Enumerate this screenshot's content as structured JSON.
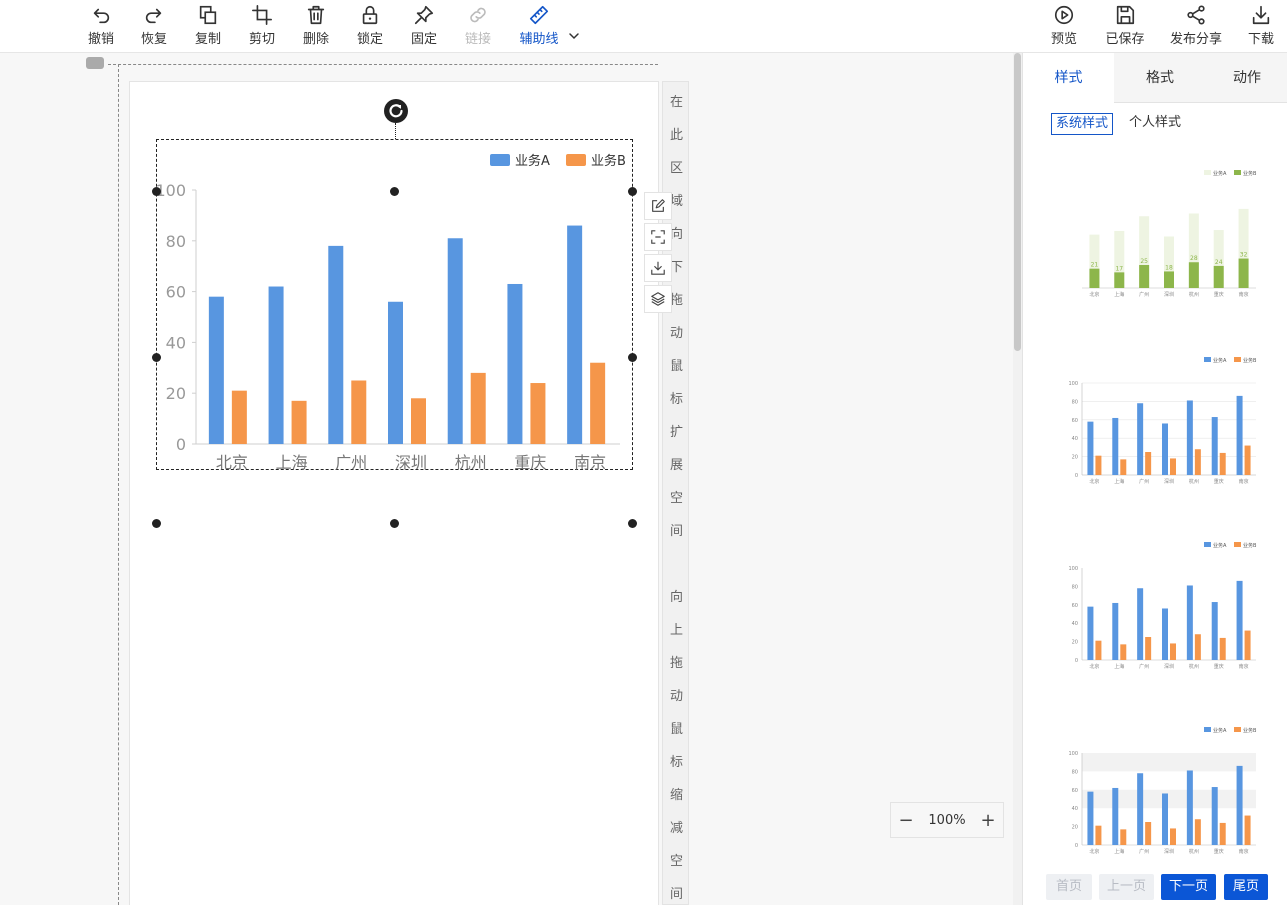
{
  "toolbar": {
    "left": [
      {
        "label": "撤销",
        "icon": "undo-icon"
      },
      {
        "label": "恢复",
        "icon": "redo-icon"
      },
      {
        "label": "复制",
        "icon": "copy-icon"
      },
      {
        "label": "剪切",
        "icon": "crop-icon"
      },
      {
        "label": "删除",
        "icon": "trash-icon"
      },
      {
        "label": "锁定",
        "icon": "lock-icon"
      },
      {
        "label": "固定",
        "icon": "pin-icon"
      },
      {
        "label": "链接",
        "icon": "link-icon"
      },
      {
        "label": "辅助线",
        "icon": "ruler-icon"
      }
    ],
    "right": [
      {
        "label": "预览",
        "icon": "play-icon"
      },
      {
        "label": "已保存",
        "icon": "save-icon"
      },
      {
        "label": "发布分享",
        "icon": "share-icon"
      },
      {
        "label": "下载",
        "icon": "download-icon"
      }
    ]
  },
  "canvas": {
    "hint_top": [
      "在",
      "此",
      "区",
      "域",
      "向",
      "下",
      "拖",
      "动",
      "鼠",
      "标",
      "扩",
      "展",
      "空",
      "间"
    ],
    "hint_bottom": [
      "向",
      "上",
      "拖",
      "动",
      "鼠",
      "标",
      "缩",
      "减",
      "空",
      "间"
    ],
    "zoom": "100%"
  },
  "chart_data": {
    "type": "bar",
    "categories": [
      "北京",
      "上海",
      "广州",
      "深圳",
      "杭州",
      "重庆",
      "南京"
    ],
    "series": [
      {
        "name": "业务A",
        "values": [
          58,
          62,
          78,
          56,
          81,
          63,
          86
        ],
        "color": "#5896e0"
      },
      {
        "name": "业务B",
        "values": [
          21,
          17,
          25,
          18,
          28,
          24,
          32
        ],
        "color": "#f5964a"
      }
    ],
    "ylim": [
      0,
      100
    ],
    "yticks": [
      0,
      20,
      40,
      60,
      80,
      100
    ],
    "legend": "top-right",
    "grid": false
  },
  "panel": {
    "tabs": [
      "样式",
      "格式",
      "动作"
    ],
    "active_tab": "样式",
    "subtabs": [
      "系统样式",
      "个人样式"
    ],
    "active_subtab": "系统样式",
    "pagination": {
      "first": "首页",
      "prev": "上一页",
      "next": "下一页",
      "last": "尾页"
    }
  },
  "colors": {
    "accent": "#1456c8",
    "series_a": "#5896e0",
    "series_b": "#f5964a",
    "green_light": "#eef4e2",
    "green_dark": "#8db64b"
  }
}
